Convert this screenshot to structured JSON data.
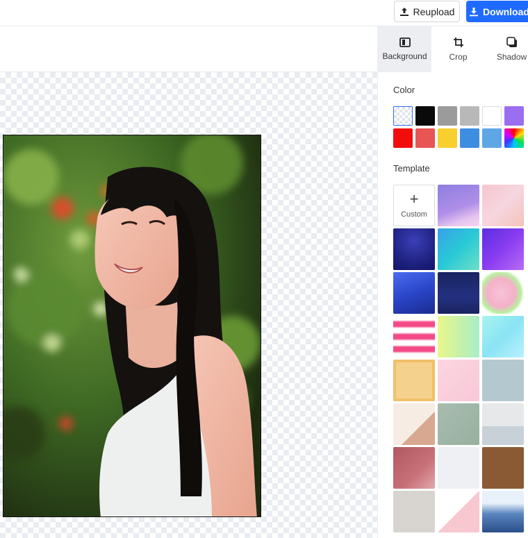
{
  "toolbar": {
    "reupload_label": "Reupload",
    "download_label": "Download",
    "reupload_icon": "upload-icon",
    "download_icon": "download-icon"
  },
  "panel": {
    "tabs": [
      {
        "label": "Background",
        "icon": "background-icon",
        "active": true
      },
      {
        "label": "Crop",
        "icon": "crop-icon",
        "active": false
      },
      {
        "label": "Shadow",
        "icon": "shadow-icon",
        "active": false
      }
    ],
    "color_title": "Color",
    "colors": [
      "transparent",
      "#0a0a0a",
      "#9b9b9b",
      "#b8b8b8",
      "#ffffff",
      "#9b6df0",
      "#f20d0d",
      "#e85555",
      "#f8cf2e",
      "#3d8de0",
      "#5fa6e6",
      "rainbow"
    ],
    "template_title": "Template",
    "custom_label": "Custom",
    "accent_color": "#1f6bff"
  }
}
